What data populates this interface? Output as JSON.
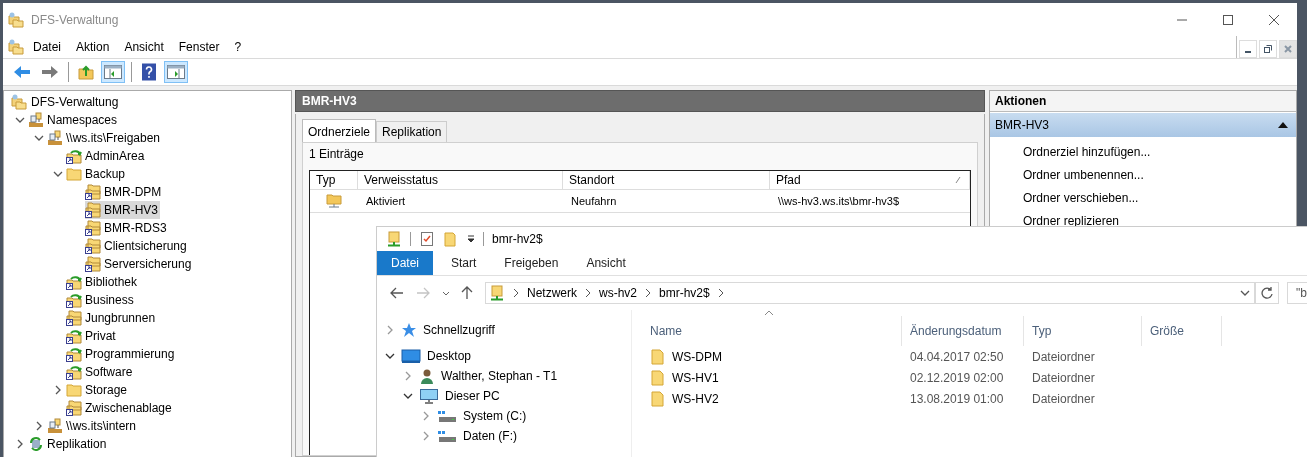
{
  "window": {
    "title": "DFS-Verwaltung"
  },
  "menu": [
    "Datei",
    "Aktion",
    "Ansicht",
    "Fenster",
    "?"
  ],
  "toolbar": [
    {
      "kind": "back",
      "selected": false
    },
    {
      "kind": "forward",
      "selected": false
    },
    {
      "kind": "separator"
    },
    {
      "kind": "up",
      "selected": false
    },
    {
      "kind": "tree-toggle",
      "selected": true
    },
    {
      "kind": "separator"
    },
    {
      "kind": "help",
      "selected": false
    },
    {
      "kind": "actions-toggle",
      "selected": true
    }
  ],
  "tree": {
    "label": "DFS-Verwaltung",
    "kind": "root",
    "selected": false,
    "children": [
      {
        "label": "Namespaces",
        "kind": "namespaces",
        "expanded": true,
        "selected": false,
        "children": [
          {
            "label": "\\\\ws.its\\Freigaben",
            "kind": "namespace",
            "expanded": true,
            "selected": false,
            "children": [
              {
                "label": "AdminArea",
                "kind": "synced-folder",
                "selected": false
              },
              {
                "label": "Backup",
                "kind": "folder",
                "expanded": true,
                "selected": false,
                "children": [
                  {
                    "label": "BMR-DPM",
                    "kind": "linked-folder",
                    "selected": false
                  },
                  {
                    "label": "BMR-HV3",
                    "kind": "linked-folder",
                    "selected": true
                  },
                  {
                    "label": "BMR-RDS3",
                    "kind": "linked-folder",
                    "selected": false
                  },
                  {
                    "label": "Clientsicherung",
                    "kind": "linked-folder",
                    "selected": false
                  },
                  {
                    "label": "Serversicherung",
                    "kind": "linked-folder",
                    "selected": false
                  }
                ]
              },
              {
                "label": "Bibliothek",
                "kind": "synced-folder",
                "selected": false
              },
              {
                "label": "Business",
                "kind": "synced-folder",
                "selected": false
              },
              {
                "label": "Jungbrunnen",
                "kind": "linked-folder",
                "selected": false
              },
              {
                "label": "Privat",
                "kind": "synced-folder",
                "selected": false
              },
              {
                "label": "Programmierung",
                "kind": "synced-folder",
                "selected": false
              },
              {
                "label": "Software",
                "kind": "synced-folder",
                "selected": false
              },
              {
                "label": "Storage",
                "kind": "folder",
                "expanded": false,
                "selected": false
              },
              {
                "label": "Zwischenablage",
                "kind": "linked-folder",
                "selected": false
              }
            ]
          },
          {
            "label": "\\\\ws.its\\intern",
            "kind": "namespace",
            "expanded": false,
            "selected": false
          }
        ]
      },
      {
        "label": "Replikation",
        "kind": "replication",
        "expanded": false,
        "selected": false
      }
    ]
  },
  "detail": {
    "title": "BMR-HV3",
    "tabs": [
      {
        "label": "Ordnerziele",
        "selected": true
      },
      {
        "label": "Replikation",
        "selected": false
      }
    ],
    "count": "1 Einträge",
    "columns": [
      {
        "label": "Typ",
        "sorted": false
      },
      {
        "label": "Verweisstatus",
        "sorted": false
      },
      {
        "label": "Standort",
        "sorted": false
      },
      {
        "label": "Pfad",
        "sorted": true
      }
    ],
    "rows": [
      {
        "status": "Aktiviert",
        "location": "Neufahrn",
        "path": "\\\\ws-hv3.ws.its\\bmr-hv3$"
      }
    ]
  },
  "actions": {
    "title": "Aktionen",
    "section": "BMR-HV3",
    "expanded": true,
    "items": [
      "Ordnerziel hinzufügen...",
      "Ordner umbenennen...",
      "Ordner verschieben...",
      "Ordner replizieren"
    ]
  },
  "explorer": {
    "title": "bmr-hv2$",
    "tabs": [
      {
        "label": "Datei",
        "selected": true
      },
      {
        "label": "Start",
        "selected": false
      },
      {
        "label": "Freigeben",
        "selected": false
      },
      {
        "label": "Ansicht",
        "selected": false
      }
    ],
    "crumbs": [
      "Netzwerk",
      "ws-hv2",
      "bmr-hv2$"
    ],
    "search": "\"b",
    "nav": [
      {
        "label": "Schnellzugriff",
        "kind": "quick-access",
        "expanded": false
      },
      {
        "label": "Desktop",
        "kind": "desktop",
        "expanded": true,
        "children": [
          {
            "label": "Walther, Stephan - T1",
            "kind": "user",
            "expanded": false
          },
          {
            "label": "Dieser PC",
            "kind": "pc",
            "expanded": true,
            "children": [
              {
                "label": "System (C:)",
                "kind": "drive",
                "expanded": false
              },
              {
                "label": "Daten (F:)",
                "kind": "drive",
                "expanded": false
              }
            ]
          }
        ]
      }
    ],
    "columns": [
      "Name",
      "Änderungsdatum",
      "Typ",
      "Größe"
    ],
    "files": [
      {
        "name": "WS-DPM",
        "date": "04.04.2017 02:50",
        "type": "Dateiordner"
      },
      {
        "name": "WS-HV1",
        "date": "02.12.2019 02:00",
        "type": "Dateiordner"
      },
      {
        "name": "WS-HV2",
        "date": "13.08.2019 01:00",
        "type": "Dateiordner"
      }
    ]
  }
}
